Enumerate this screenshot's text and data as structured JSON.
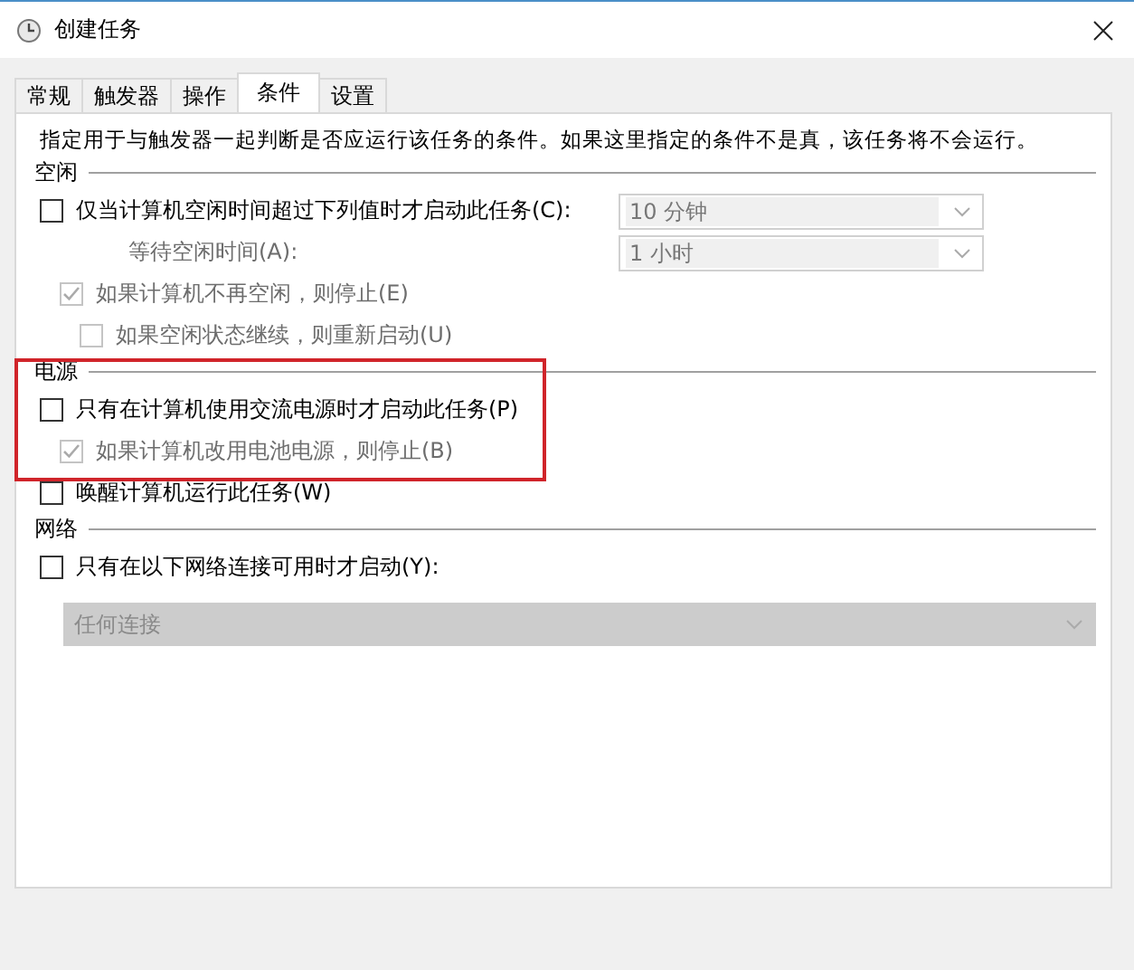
{
  "window": {
    "title": "创建任务"
  },
  "tabs": [
    {
      "label": "常规",
      "selected": false
    },
    {
      "label": "触发器",
      "selected": false
    },
    {
      "label": "操作",
      "selected": false
    },
    {
      "label": "条件",
      "selected": true
    },
    {
      "label": "设置",
      "selected": false
    }
  ],
  "intro": "指定用于与触发器一起判断是否应运行该任务的条件。如果这里指定的条件不是真，该任务将不会运行。",
  "sections": [
    {
      "title": "空闲",
      "highlighted": false,
      "items": [
        {
          "kind": "checkbox",
          "label": "仅当计算机空闲时间超过下列值时才启动此任务(C):",
          "checked": false,
          "disabled": false,
          "dropdown": {
            "value": "10 分钟",
            "disabled": true
          },
          "children": [
            {
              "kind": "field",
              "label": "等待空闲时间(A):",
              "disabled": true,
              "dropdown": {
                "value": "1 小时",
                "disabled": true
              }
            },
            {
              "kind": "checkbox",
              "label": "如果计算机不再空闲，则停止(E)",
              "checked": true,
              "disabled": true,
              "children": [
                {
                  "kind": "checkbox",
                  "label": "如果空闲状态继续，则重新启动(U)",
                  "checked": false,
                  "disabled": true
                }
              ]
            }
          ]
        }
      ]
    },
    {
      "title": "电源",
      "highlighted": true,
      "items": [
        {
          "kind": "checkbox",
          "label": "只有在计算机使用交流电源时才启动此任务(P)",
          "checked": false,
          "disabled": false,
          "children": [
            {
              "kind": "checkbox",
              "label": "如果计算机改用电池电源，则停止(B)",
              "checked": true,
              "disabled": true
            }
          ]
        },
        {
          "kind": "checkbox",
          "label": "唤醒计算机运行此任务(W)",
          "checked": false,
          "disabled": false
        }
      ]
    },
    {
      "title": "网络",
      "highlighted": false,
      "items": [
        {
          "kind": "checkbox",
          "label": "只有在以下网络连接可用时才启动(Y):",
          "checked": false,
          "disabled": false,
          "children": [
            {
              "kind": "dropdown",
              "value": "任何连接",
              "disabled": true
            }
          ]
        }
      ]
    }
  ]
}
